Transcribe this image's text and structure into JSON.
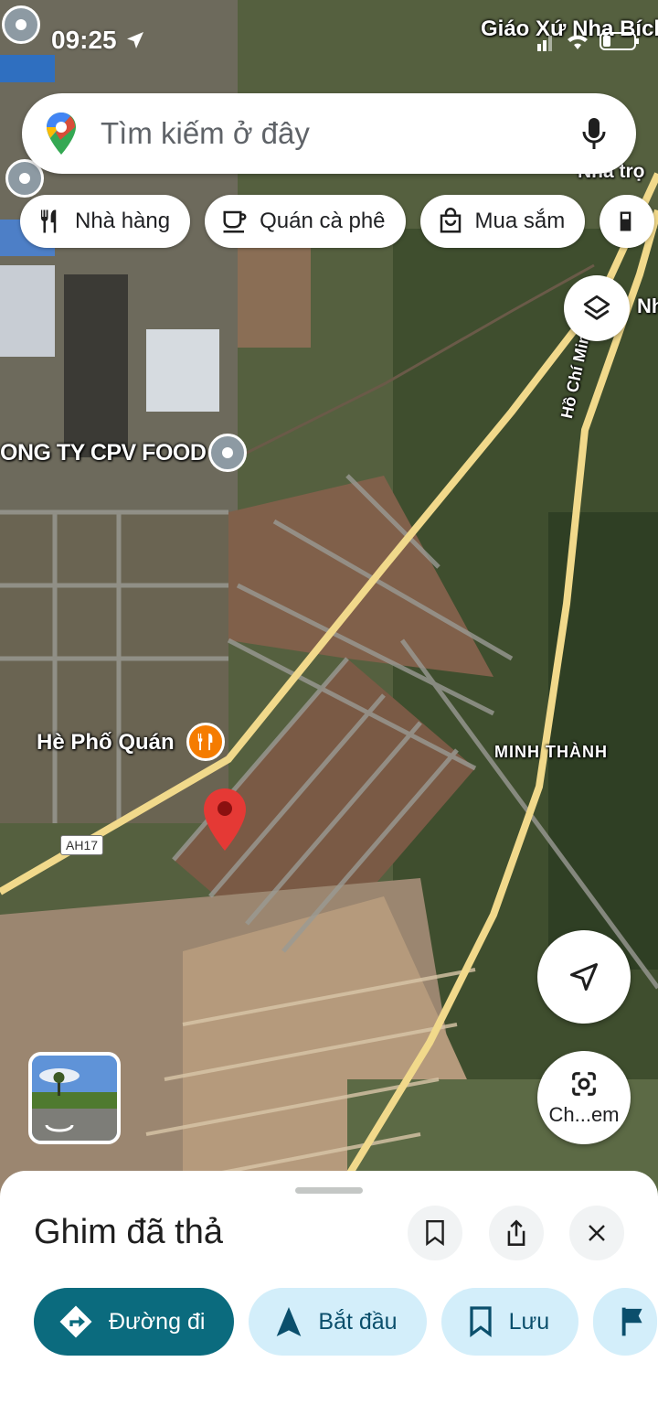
{
  "status_bar": {
    "time": "09:25"
  },
  "search": {
    "placeholder": "Tìm kiếm ở đây"
  },
  "chips": [
    {
      "label": "Nhà hàng",
      "icon": "restaurant-icon"
    },
    {
      "label": "Quán cà phê",
      "icon": "coffee-icon"
    },
    {
      "label": "Mua sắm",
      "icon": "shopping-bag-icon"
    }
  ],
  "map_labels": {
    "company": "ONG TY CPV FOOD",
    "restaurant": "Hè Phố Quán",
    "area": "MINH THÀNH",
    "church": "Giáo Xứ Nha Bích",
    "partial_top": "Nhà trọ",
    "partial_right": "Nh",
    "road_name": "Hồ Chí Minh",
    "route_shield": "AH17"
  },
  "lens_button": {
    "label": "Ch...em"
  },
  "sheet": {
    "title": "Ghim đã thả",
    "actions": {
      "directions": "Đường đi",
      "start": "Bắt đầu",
      "save": "Lưu"
    }
  },
  "colors": {
    "primary_action": "#0b6b7e",
    "secondary_action": "#d3eefa",
    "pin": "#e53935",
    "road": "#f1d98b"
  }
}
